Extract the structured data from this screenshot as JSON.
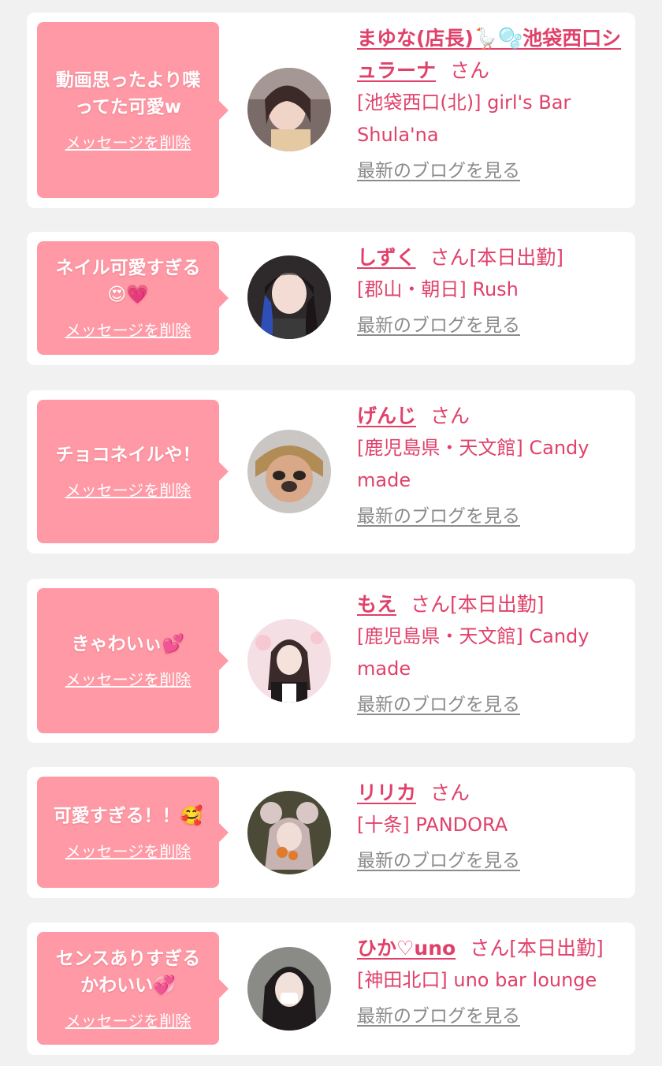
{
  "cards": [
    {
      "message": "動画思ったより喋ってた可愛w",
      "delete_label": "メッセージを削除",
      "name": "まゆな(店長)🪿🫧池袋西口シュラーナ",
      "suffix": "さん",
      "shop": "[池袋西口(北)] girl's Bar Shula'na",
      "blog_label": "最新のブログを見る"
    },
    {
      "message": "ネイル可愛すぎる😍💗",
      "delete_label": "メッセージを削除",
      "name": "しずく",
      "suffix": "さん[本日出勤]",
      "shop": "[郡山・朝日] Rush",
      "blog_label": "最新のブログを見る"
    },
    {
      "message": "チョコネイルや！",
      "delete_label": "メッセージを削除",
      "name": "げんじ",
      "suffix": "さん",
      "shop": "[鹿児島県・天文館] Candy made",
      "blog_label": "最新のブログを見る"
    },
    {
      "message": "きゃわいぃ💕",
      "delete_label": "メッセージを削除",
      "name": "もえ",
      "suffix": "さん[本日出勤]",
      "shop": "[鹿児島県・天文館] Candy made",
      "blog_label": "最新のブログを見る"
    },
    {
      "message": "可愛すぎる！！🥰",
      "delete_label": "メッセージを削除",
      "name": "リリカ",
      "suffix": "さん",
      "shop": "[十条] PANDORA",
      "blog_label": "最新のブログを見る"
    },
    {
      "message": "センスありすぎるかわいい💞",
      "delete_label": "メッセージを削除",
      "name": "ひか♡uno",
      "suffix": "さん[本日出勤]",
      "shop": "[神田北口] uno bar lounge",
      "blog_label": "最新のブログを見る"
    }
  ],
  "colors": {
    "background": "#f1f1f1",
    "card": "#ffffff",
    "bubble": "#fe99a5",
    "accent": "#e0416a",
    "link_gray": "#8b8b8b"
  },
  "icons": [
    "user-avatar-photo"
  ]
}
